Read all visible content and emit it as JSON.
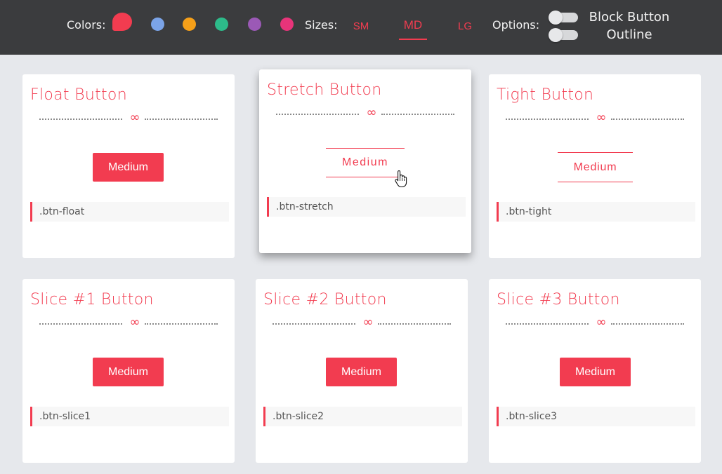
{
  "topbar": {
    "colors_label": "Colors:",
    "sizes_label": "Sizes:",
    "options_label": "Options:",
    "swatches": [
      {
        "name": "red",
        "color": "#f23c50",
        "selected": true
      },
      {
        "name": "blue",
        "color": "#7ba4e8"
      },
      {
        "name": "orange",
        "color": "#f6a019"
      },
      {
        "name": "green",
        "color": "#2dbb8a"
      },
      {
        "name": "purple",
        "color": "#9b59b6"
      },
      {
        "name": "pink",
        "color": "#e8347a"
      }
    ],
    "sizes": [
      {
        "label": "SM"
      },
      {
        "label": "MD",
        "selected": true
      },
      {
        "label": "LG"
      }
    ],
    "options": [
      {
        "label": "Block Button",
        "on": false
      },
      {
        "label": "Outline",
        "on": false
      }
    ]
  },
  "accent_color": "#f23c50",
  "divider_symbol": "∞",
  "cards": [
    {
      "title": "Float Button",
      "button_label": "Medium",
      "class_name": ".btn-float"
    },
    {
      "title": "Stretch Button",
      "button_label": "Medium",
      "class_name": ".btn-stretch"
    },
    {
      "title": "Tight Button",
      "button_label": "Medium",
      "class_name": ".btn-tight"
    },
    {
      "title": "Slice #1 Button",
      "button_label": "Medium",
      "class_name": ".btn-slice1"
    },
    {
      "title": "Slice #2 Button",
      "button_label": "Medium",
      "class_name": ".btn-slice2"
    },
    {
      "title": "Slice #3 Button",
      "button_label": "Medium",
      "class_name": ".btn-slice3"
    }
  ]
}
